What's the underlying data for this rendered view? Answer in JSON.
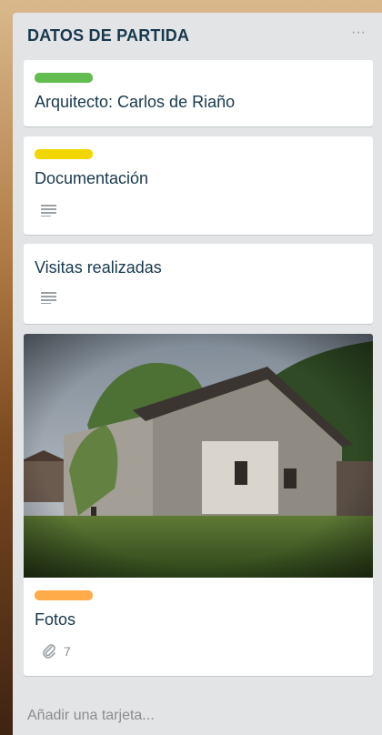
{
  "list": {
    "title": "DATOS DE PARTIDA",
    "menu_icon": "ellipsis-icon",
    "add_card_placeholder": "Añadir una tarjeta...",
    "cards": [
      {
        "title": "Arquitecto: Carlos de Riaño",
        "label_color": "#61bd4f"
      },
      {
        "title": "Documentación",
        "label_color": "#f2d600",
        "has_description": true
      },
      {
        "title": "Visitas realizadas",
        "has_description": true
      },
      {
        "title": "Fotos",
        "label_color": "#ffab4a",
        "cover": "photo of an old stone farmhouse",
        "attachments": "7",
        "attachment_icon": "paperclip-icon"
      }
    ]
  },
  "colors": {
    "list_bg": "#e2e4e6",
    "card_bg": "#ffffff",
    "title_text": "#17394d",
    "muted_text": "#8c8c8c"
  }
}
